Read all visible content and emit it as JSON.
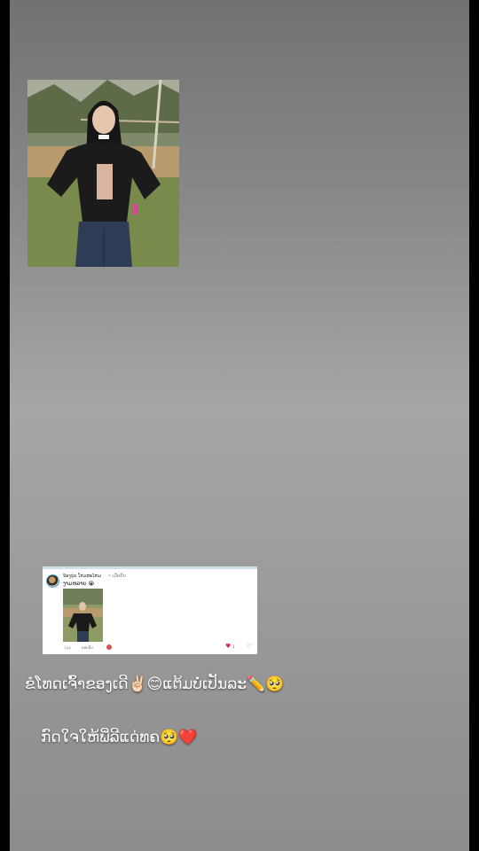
{
  "background": {
    "edge_color": "#000000",
    "gradient_top": "#727272",
    "gradient_mid": "#a6a6a6",
    "gradient_bottom": "#8c8c8c"
  },
  "photo": {
    "subject": "woman in black leather jacket standing in grassy field"
  },
  "comment_card": {
    "username": "ນ້ອງນຸ່ນ ໂສມສະໄຫມ",
    "time": "• ເມື່ອຄືນ",
    "text": "ງາມຫລາຍ 😭",
    "meta_time": "1ຊມ",
    "reply_label": "ຕອບກັບ",
    "like_count": "1",
    "icons": {
      "like": "heart-icon",
      "dislike": "dislike-icon"
    },
    "heart_color": "#e0245e"
  },
  "captions": {
    "line1": "ຂໍໂທດເຈົ້າຂອງເດີ✌🏻😊ແຕ້ມບໍ່ເປັນລະ✏️🥺",
    "line2": "ກົດໃຈໃຫ້ພີ່ລີແດ່ທຄ🥺❤️"
  }
}
